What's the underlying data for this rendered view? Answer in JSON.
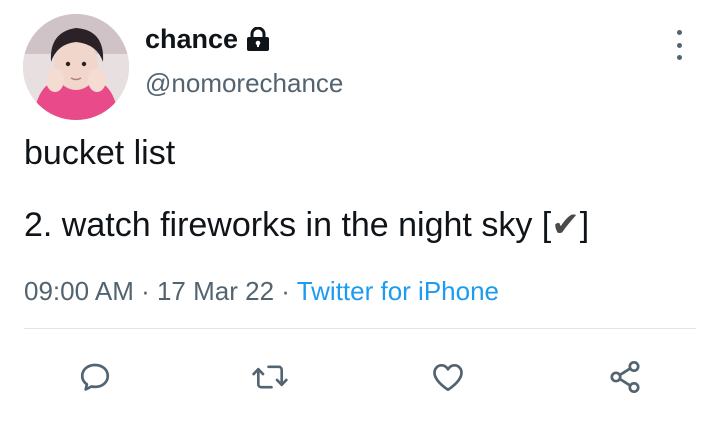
{
  "tweet": {
    "display_name": "chance",
    "handle": "@nomorechance",
    "protected_icon": "lock-icon",
    "more_icon": "more-vertical-icon",
    "text_line_1": "bucket list",
    "text_line_2_prefix": "2. watch fireworks in the night sky [",
    "text_line_2_check": "✔",
    "text_line_2_suffix": "]",
    "time": "09:00 AM",
    "separator_1": " · ",
    "date": "17 Mar 22",
    "separator_2": " · ",
    "source": "Twitter for iPhone"
  },
  "actions": [
    {
      "icon": "reply-icon"
    },
    {
      "icon": "retweet-icon"
    },
    {
      "icon": "like-icon"
    },
    {
      "icon": "share-icon"
    }
  ],
  "colors": {
    "text_primary": "#0f1419",
    "text_secondary": "#536471",
    "link": "#1d9bf0",
    "divider": "#e1e5e8"
  }
}
